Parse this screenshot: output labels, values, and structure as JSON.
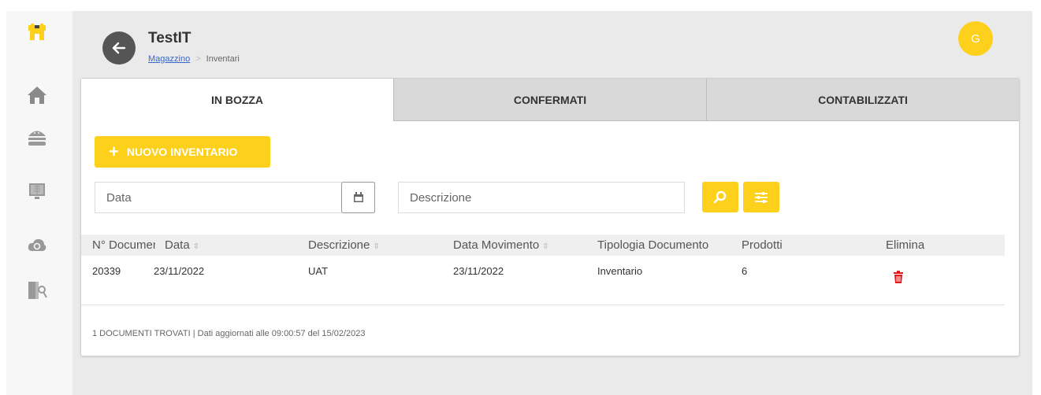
{
  "app": {
    "title": "TestIT",
    "avatar_initial": "G",
    "accent": "#fcd01b"
  },
  "breadcrumb": {
    "link": "Magazzino",
    "current": "Inventari"
  },
  "sidebar": {
    "icons": [
      "shop-icon",
      "home-icon",
      "burger-icon",
      "pos-terminal-icon",
      "cloud-icon",
      "door-key-icon"
    ]
  },
  "tabs": [
    {
      "label": "IN BOZZA",
      "active": true
    },
    {
      "label": "CONFERMATI",
      "active": false
    },
    {
      "label": "CONTABILIZZATI",
      "active": false
    }
  ],
  "toolbar": {
    "new_label": "NUOVO INVENTARIO"
  },
  "filters": {
    "date_placeholder": "Data",
    "description_placeholder": "Descrizione"
  },
  "table": {
    "columns": [
      "N° Documento",
      "Data",
      "Descrizione",
      "Data Movimento",
      "Tipologia Documento",
      "Prodotti",
      "Elimina"
    ],
    "rows": [
      {
        "n_doc": "20339",
        "data": "23/11/2022",
        "descrizione": "UAT",
        "data_movimento": "23/11/2022",
        "tipologia": "Inventario",
        "prodotti": "6"
      }
    ]
  },
  "footer": "1 DOCUMENTI TROVATI | Dati aggiornati alle 09:00:57 del 15/02/2023"
}
